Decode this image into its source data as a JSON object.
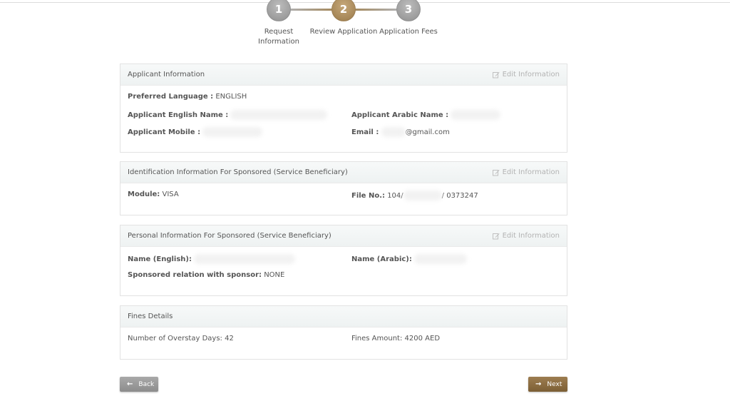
{
  "stepper": {
    "steps": [
      {
        "number": "1",
        "label_line1": "Request",
        "label_line2": "Information"
      },
      {
        "number": "2",
        "label_line1": "Review Application",
        "label_line2": ""
      },
      {
        "number": "3",
        "label_line1": "Application Fees",
        "label_line2": ""
      }
    ],
    "active_color": "#a8885a",
    "inactive_color": "#a6a6a6"
  },
  "edit_label": "Edit Information",
  "applicant": {
    "title": "Applicant Information",
    "preferred_language_label": "Preferred Language :",
    "preferred_language_value": "ENGLISH",
    "english_name_label": "Applicant English Name :",
    "arabic_name_label": "Applicant Arabic Name :",
    "mobile_label": "Applicant Mobile :",
    "email_label": "Email :",
    "email_value": "@gmail.com"
  },
  "identification": {
    "title": "Identification Information For Sponsored (Service Beneficiary)",
    "module_label": "Module:",
    "module_value": "VISA",
    "file_label": "File No.:",
    "file_prefix": "104/",
    "file_suffix": "/ 0373247"
  },
  "personal": {
    "title": "Personal Information For Sponsored (Service Beneficiary)",
    "name_en_label": "Name (English):",
    "name_ar_label": "Name (Arabic):",
    "relation_label": "Sponsored relation with sponsor:",
    "relation_value": "NONE"
  },
  "fines": {
    "title": "Fines Details",
    "overstay_label": "Number of Overstay Days:",
    "overstay_value": "42",
    "amount_label": "Fines Amount:",
    "amount_value": "4200 AED"
  },
  "buttons": {
    "back_label": "Back",
    "next_label": "Next",
    "back_color": "#999999",
    "next_color": "#8a6c41"
  }
}
